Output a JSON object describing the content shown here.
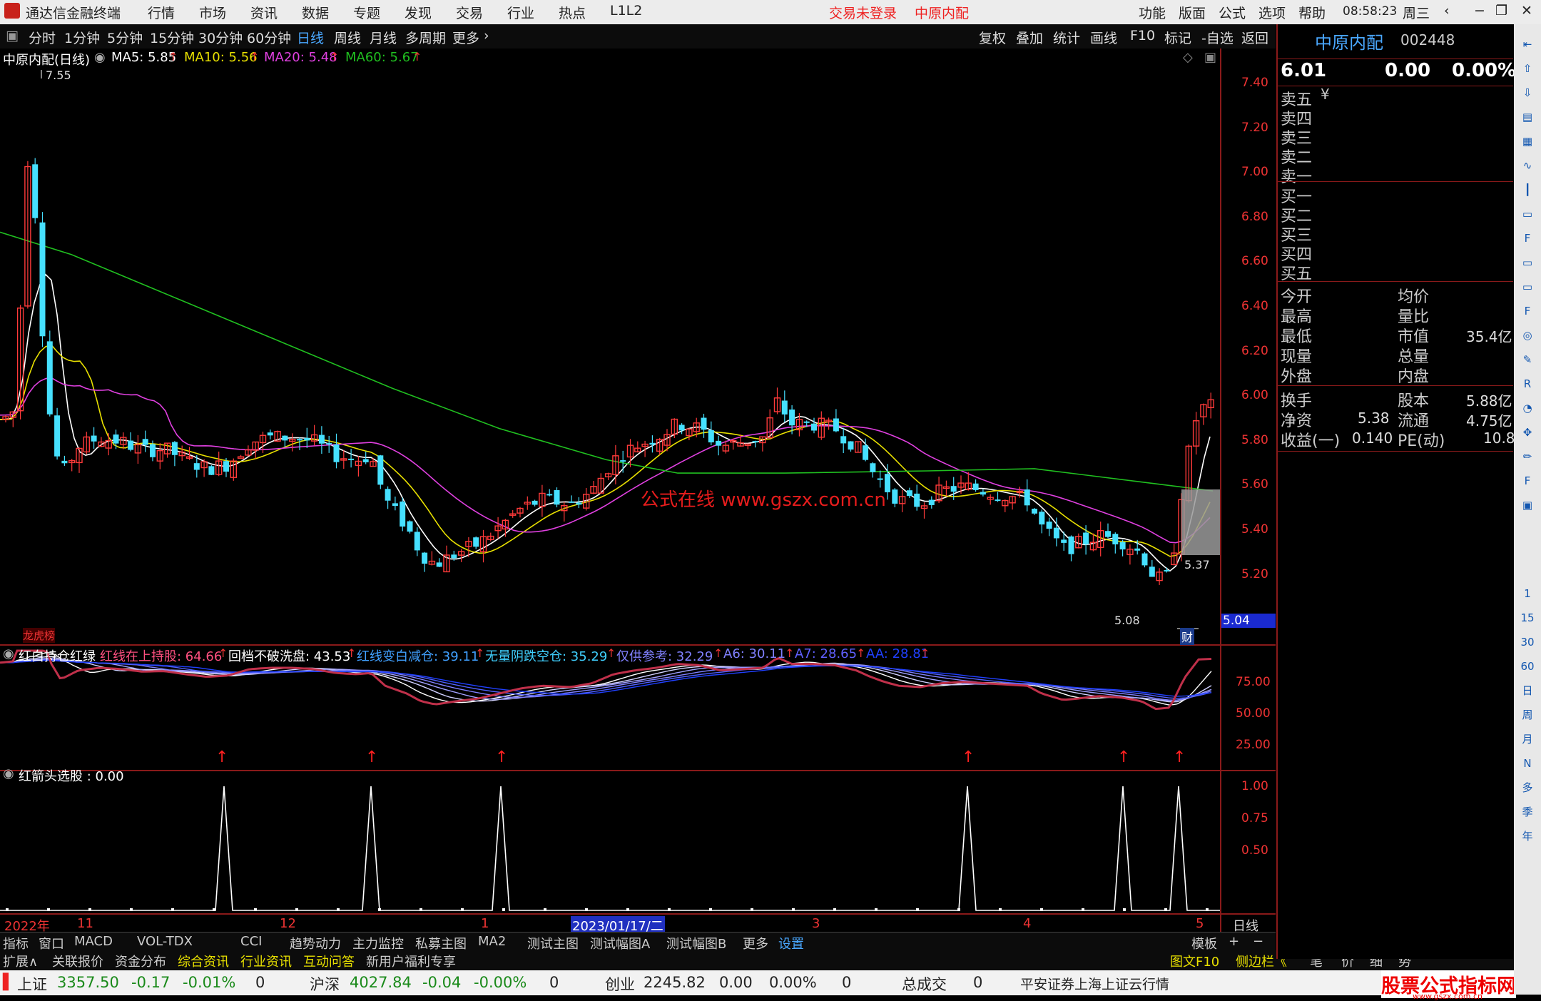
{
  "menubar": {
    "app_title": "通达信金融终端",
    "items": [
      "行情",
      "市场",
      "资讯",
      "数据",
      "专题",
      "发现",
      "交易",
      "行业",
      "热点",
      "L1L2"
    ],
    "trade_status": "交易未登录",
    "stock_name": "中原内配",
    "right_items": [
      "功能",
      "版面",
      "公式",
      "选项",
      "帮助"
    ],
    "time": "08:58:23",
    "weekday": "周三"
  },
  "toolbar": {
    "periods": [
      "分时",
      "1分钟",
      "5分钟",
      "15分钟",
      "30分钟",
      "60分钟",
      "日线",
      "周线",
      "月线",
      "多周期",
      "更多"
    ],
    "active_period": "日线",
    "right_buttons": [
      "复权",
      "叠加",
      "统计",
      "画线",
      "F10",
      "标记",
      "-自选",
      "返回"
    ]
  },
  "main_chart": {
    "title": "中原内配(日线)",
    "ma": [
      {
        "label": "MA5: 5.85",
        "color": "#ffffff"
      },
      {
        "label": "MA10: 5.56",
        "color": "#e8e000"
      },
      {
        "label": "MA20: 5.48",
        "color": "#e040e0"
      },
      {
        "label": "MA60: 5.67",
        "color": "#20c020"
      }
    ],
    "y_ticks": [
      "7.40",
      "7.20",
      "7.00",
      "6.80",
      "6.60",
      "6.40",
      "6.20",
      "6.00",
      "5.80",
      "5.60",
      "5.40",
      "5.20"
    ],
    "high_label": "7.55",
    "low_label": "5.08",
    "current_label": "5.37",
    "price_box": "5.04",
    "watermark": "公式在线 www.gszx.com.cn",
    "badge_left": "龙虎榜",
    "badge_right": "财"
  },
  "indicator1": {
    "title": "红白持仓红绿",
    "items": [
      {
        "label": "红线在上持股: 64.66",
        "color": "#ff5080"
      },
      {
        "label": "回档不破洗盘: 43.53",
        "color": "#ffffff"
      },
      {
        "label": "红线变白减仓: 39.11",
        "color": "#40a0ff"
      },
      {
        "label": "无量阴跌空仓: 35.29",
        "color": "#40d0ff"
      },
      {
        "label": "仅供参考: 32.29",
        "color": "#8080ff"
      },
      {
        "label": "A6: 30.11",
        "color": "#8080ff"
      },
      {
        "label": "A7: 28.65",
        "color": "#6060ff"
      },
      {
        "label": "AA: 28.81",
        "color": "#2040ff"
      }
    ],
    "y_ticks": [
      "75.00",
      "50.00",
      "25.00"
    ]
  },
  "indicator2": {
    "title": "红箭头选股 : 0.00",
    "y_ticks": [
      "1.00",
      "0.75",
      "0.50"
    ]
  },
  "x_axis": {
    "labels": [
      "2022年",
      "11",
      "12",
      "1",
      "2023/01/17/二",
      "3",
      "4",
      "5"
    ],
    "period": "日线"
  },
  "tabbar1": {
    "tabs": [
      "指标",
      "窗口",
      "MACD",
      "VOL-TDX",
      "CCI",
      "趋势动力",
      "主力监控",
      "私募主图",
      "MA2",
      "测试主图",
      "测试幅图A",
      "测试幅图B",
      "更多",
      "设置"
    ],
    "right": [
      "模板",
      "+",
      "−"
    ]
  },
  "tabbar2": {
    "tabs": [
      "扩展∧",
      "关联报价",
      "资金分布",
      "综合资讯",
      "行业资讯",
      "互动问答",
      "新用户福利专享"
    ],
    "right": [
      "图文F10",
      "侧边栏《",
      "笔",
      "价",
      "细",
      "势"
    ]
  },
  "status": {
    "idx": [
      {
        "name": "上证",
        "value": "3357.50",
        "chg": "-0.17",
        "pct": "-0.01%",
        "vol": "0"
      },
      {
        "name": "沪深",
        "value": "4027.84",
        "chg": "-0.04",
        "pct": "-0.00%",
        "vol": "0"
      },
      {
        "name": "创业",
        "value": "2245.82",
        "chg": "0.00",
        "pct": "0.00%",
        "vol": "0"
      }
    ],
    "total_label": "总成交",
    "total_value": "0",
    "broker": "平安证券上海上证云行情",
    "corner_logo": "股票公式指标网",
    "corner_url": "www.gszx.com.cn"
  },
  "quote": {
    "name": "中原内配",
    "code": "002448",
    "price": "6.01",
    "change": "0.00",
    "pct": "0.00%",
    "sell": [
      "卖五",
      "卖四",
      "卖三",
      "卖二",
      "卖一"
    ],
    "buy": [
      "买一",
      "买二",
      "买三",
      "买四",
      "买五"
    ],
    "currency_mark": "¥",
    "stats_left": [
      "今开",
      "最高",
      "最低",
      "现量",
      "外盘"
    ],
    "stats_right": [
      "均价",
      "量比",
      "市值",
      "总量",
      "内盘"
    ],
    "mkt_value": "35.4亿",
    "f_left": [
      "换手",
      "净资",
      "收益(一)"
    ],
    "f_right": [
      "股本",
      "流通",
      "PE(动)"
    ],
    "net_asset": "5.38",
    "eps": "0.140",
    "share": "5.88亿",
    "float": "4.75亿",
    "pe": "10.8"
  },
  "iconbar": {
    "labels": [
      "1",
      "15",
      "30",
      "60",
      "日",
      "周",
      "月",
      "N",
      "多",
      "季",
      "年"
    ]
  },
  "colors": {
    "up": "#ff3a3a",
    "down": "#46e0ff",
    "ma5": "#ffffff",
    "ma10": "#e8e000",
    "ma20": "#e040e0",
    "ma60": "#20c020"
  }
}
